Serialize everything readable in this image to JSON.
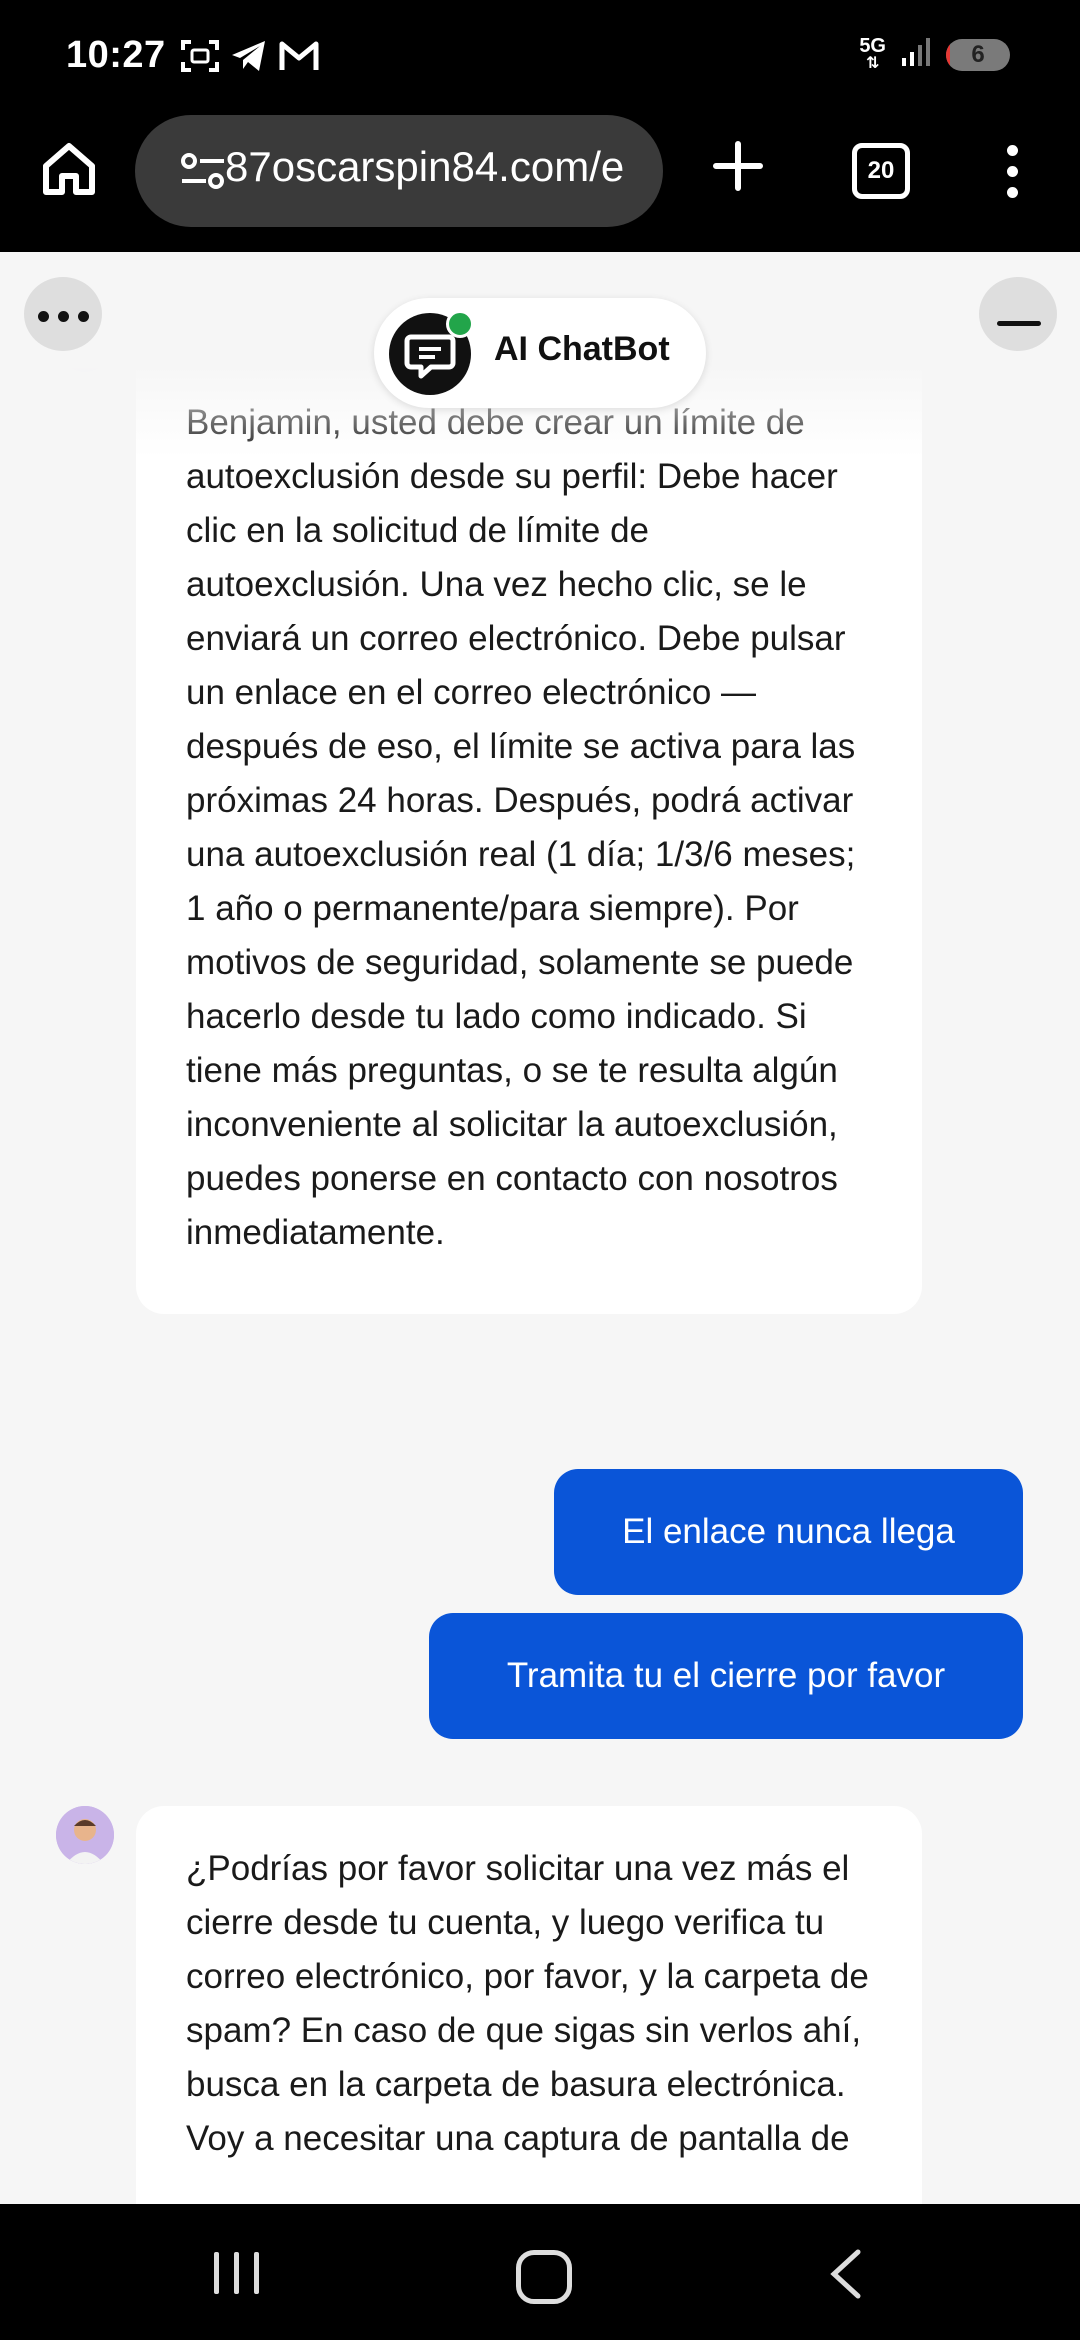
{
  "status_bar": {
    "time": "10:27",
    "network": "5G",
    "battery": "6",
    "battery_level_percent": 6,
    "icons": [
      "screenshot-icon",
      "telegram-icon",
      "gmail-icon"
    ]
  },
  "browser": {
    "url": "87oscarspin84.com/e",
    "tab_count": "20"
  },
  "chat": {
    "bot_name": "AI ChatBot",
    "messages": [
      {
        "role": "bot",
        "text": "Benjamin, usted debe crear un límite de autoexclusión desde su perfil: Debe hacer clic en la solicitud de límite de autoexclusión. Una vez hecho clic, se le enviará un correo electrónico. Debe pulsar un enlace en el correo electrónico — después de eso, el límite se activa para las próximas 24 horas. Después, podrá activar una autoexclusión real (1 día; 1/3/6 meses; 1 año o permanente/para siempre). Por motivos de seguridad, solamente se puede hacerlo desde tu lado como indicado. Si tiene más preguntas, o se te resulta algún inconveniente al solicitar la autoexclusión, puedes ponerse en contacto con nosotros inmediatamente."
      },
      {
        "role": "user",
        "text": "El enlace nunca llega"
      },
      {
        "role": "user",
        "text": "Tramita tu el cierre por favor"
      },
      {
        "role": "bot",
        "text": "¿Podrías por favor solicitar una vez más el cierre desde tu cuenta, y luego verifica tu correo electrónico, por favor, y la carpeta de spam? En caso de que sigas sin verlos ahí, busca en la carpeta de basura electrónica. Voy a necesitar una captura de pantalla de"
      }
    ]
  },
  "colors": {
    "user_bubble": "#0a55d8",
    "bot_bubble": "#ffffff",
    "online_dot": "#22a54a",
    "background": "#f6f6f6"
  }
}
